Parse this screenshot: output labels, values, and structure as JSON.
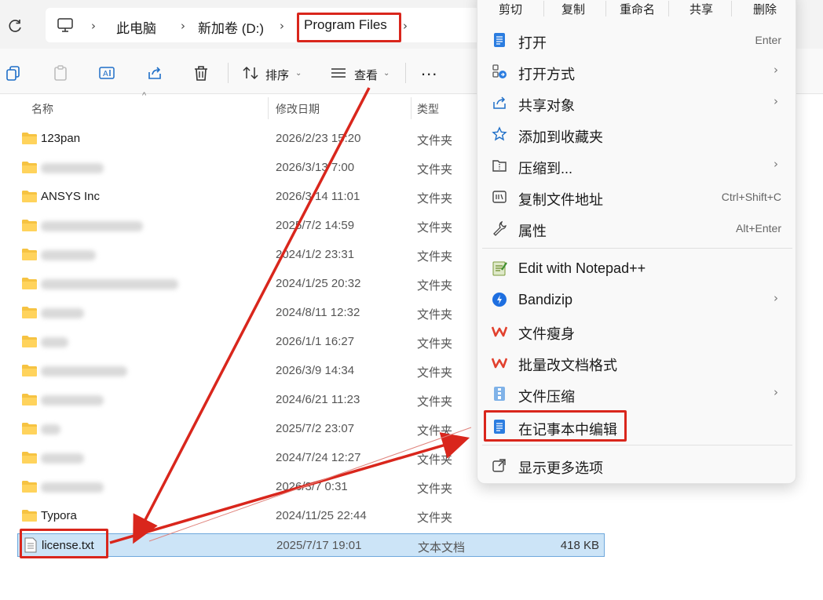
{
  "breadcrumb": {
    "items": [
      "此电脑",
      "新加卷 (D:)",
      "Program Files"
    ]
  },
  "toolbar": {
    "sort_label": "排序",
    "view_label": "查看",
    "more_label": "..."
  },
  "columns": {
    "name": "名称",
    "date": "修改日期",
    "type": "类型"
  },
  "files": [
    {
      "name": "123pan",
      "date": "2026/2/23 15:20",
      "type": "文件夹",
      "blurred": false
    },
    {
      "name": "",
      "date": "2026/3/13 7:00",
      "type": "文件夹",
      "blurred": true
    },
    {
      "name": "ANSYS Inc",
      "date": "2026/3/14 11:01",
      "type": "文件夹",
      "blurred": false
    },
    {
      "name": "",
      "date": "2025/7/2 14:59",
      "type": "文件夹",
      "blurred": true
    },
    {
      "name": "",
      "date": "2024/1/2 23:31",
      "type": "文件夹",
      "blurred": true
    },
    {
      "name": "",
      "date": "2024/1/25 20:32",
      "type": "文件夹",
      "blurred": true
    },
    {
      "name": "",
      "date": "2024/8/11 12:32",
      "type": "文件夹",
      "blurred": true
    },
    {
      "name": "",
      "date": "2026/1/1 16:27",
      "type": "文件夹",
      "blurred": true
    },
    {
      "name": "",
      "date": "2026/3/9 14:34",
      "type": "文件夹",
      "blurred": true
    },
    {
      "name": "",
      "date": "2024/6/21 11:23",
      "type": "文件夹",
      "blurred": true
    },
    {
      "name": "",
      "date": "2025/7/2 23:07",
      "type": "文件夹",
      "blurred": true
    },
    {
      "name": "",
      "date": "2024/7/24 12:27",
      "type": "文件夹",
      "blurred": true
    },
    {
      "name": "",
      "date": "2026/3/7 0:31",
      "type": "文件夹",
      "blurred": true
    },
    {
      "name": "Typora",
      "date": "2024/11/25 22:44",
      "type": "文件夹",
      "blurred": false
    }
  ],
  "selected_file": {
    "name": "license.txt",
    "date": "2025/7/17 19:01",
    "type": "文本文档",
    "size": "418 KB"
  },
  "context_menu": {
    "quick_actions": [
      "剪切",
      "复制",
      "重命名",
      "共享",
      "删除"
    ],
    "items": [
      {
        "label": "打开",
        "shortcut": "Enter",
        "icon": "notepad-icon"
      },
      {
        "label": "打开方式",
        "shortcut": "",
        "icon": "open-with-icon"
      },
      {
        "label": "共享对象",
        "shortcut": "",
        "icon": "share-icon"
      },
      {
        "label": "添加到收藏夹",
        "shortcut": "",
        "icon": "star-icon"
      },
      {
        "label": "压缩到...",
        "shortcut": "",
        "icon": "zip-folder-icon"
      },
      {
        "label": "复制文件地址",
        "shortcut": "Ctrl+Shift+C",
        "icon": "copy-path-icon"
      },
      {
        "label": "属性",
        "shortcut": "Alt+Enter",
        "icon": "wrench-icon"
      },
      {
        "label": "Edit with Notepad++",
        "shortcut": "",
        "icon": "notepadpp-icon"
      },
      {
        "label": "Bandizip",
        "shortcut": "",
        "icon": "bandizip-icon"
      },
      {
        "label": "文件瘦身",
        "shortcut": "",
        "icon": "wps-icon"
      },
      {
        "label": "批量改文档格式",
        "shortcut": "",
        "icon": "wps-icon"
      },
      {
        "label": "文件压缩",
        "shortcut": "",
        "icon": "compress-icon"
      },
      {
        "label": "在记事本中编辑",
        "shortcut": "",
        "icon": "notepad-icon"
      },
      {
        "label": "显示更多选项",
        "shortcut": "",
        "icon": "more-options-icon"
      }
    ]
  },
  "colors": {
    "highlight": "#d9261c",
    "selection": "#cce4f7",
    "folder": "#f6c342"
  }
}
